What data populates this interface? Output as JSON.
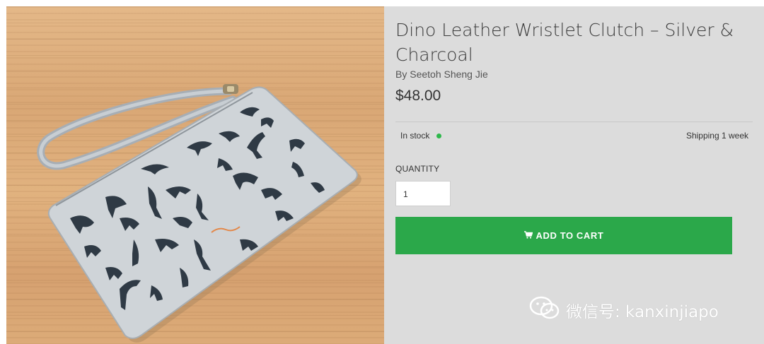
{
  "product": {
    "title": "Dino Leather Wristlet Clutch – Silver & Charcoal",
    "byline": "By Seetoh Sheng Jie",
    "price": "$48.00",
    "image_icon": "product-photo"
  },
  "availability": {
    "stock_text": "In stock",
    "stock_color": "#2eb84b",
    "shipping_text": "Shipping 1 week"
  },
  "quantity": {
    "label": "QUANTITY",
    "value": "1"
  },
  "cart": {
    "button_label": "ADD TO CART",
    "icon": "cart-icon",
    "color": "#2ba84a"
  },
  "watermark": {
    "text": "微信号: kanxinjiapo",
    "icon": "wechat-icon"
  }
}
